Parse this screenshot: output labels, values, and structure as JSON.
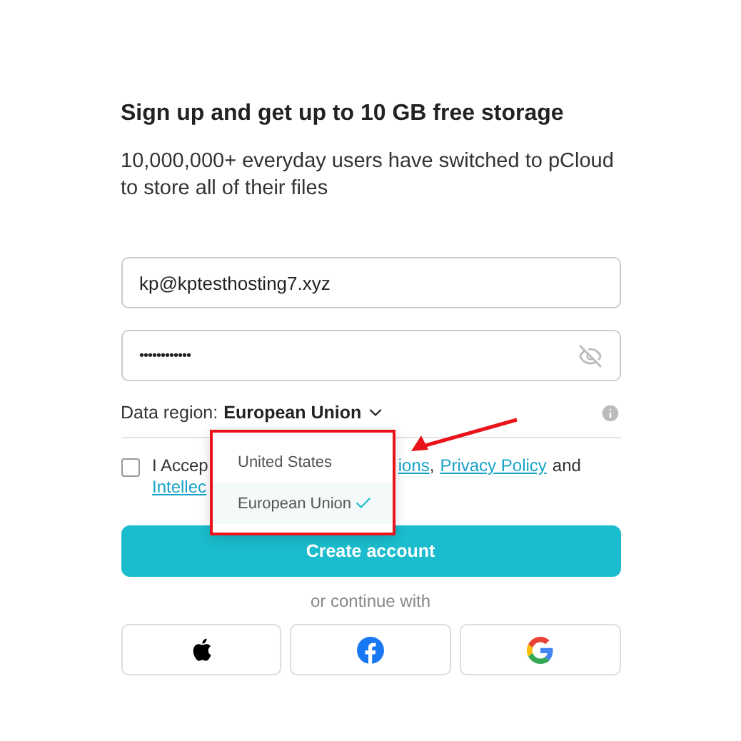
{
  "heading": "Sign up and get up to 10 GB free storage",
  "subtitle": "10,000,000+ everyday users have switched to pCloud to store all of their files",
  "email": {
    "value": "kp@kptesthosting7.xyz"
  },
  "password": {
    "value": "••••••••••••",
    "visible": false
  },
  "region": {
    "label": "Data region:",
    "value": "European Union",
    "expanded": true,
    "options": [
      {
        "label": "United States",
        "selected": false
      },
      {
        "label": "European Union",
        "selected": true
      }
    ]
  },
  "terms": {
    "checked": false,
    "line1_start": "I Accep",
    "line1_link": "ions",
    "line1_sep": ",",
    "link2": "Privacy Policy",
    "line1_end": "and",
    "line2_link": "Intellec"
  },
  "create_button": "Create account",
  "divider_text": "or continue with",
  "social": [
    {
      "kind": "apple"
    },
    {
      "kind": "facebook"
    },
    {
      "kind": "google"
    }
  ]
}
